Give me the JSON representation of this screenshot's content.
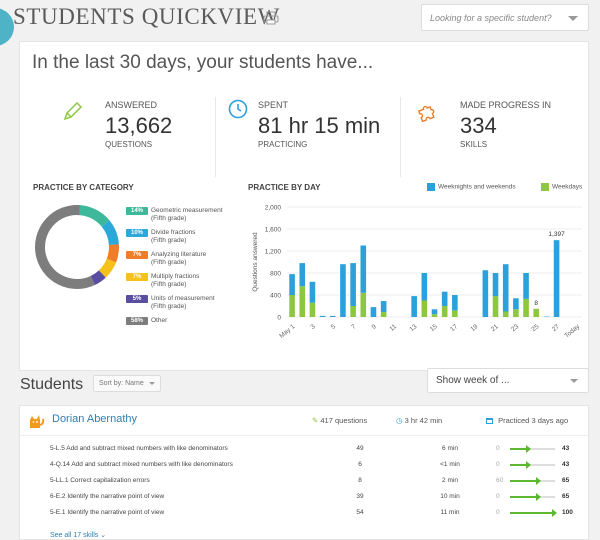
{
  "header": {
    "title": "STUDENTS QUICKVIEW",
    "search_placeholder": "Looking for a specific student?"
  },
  "summary": {
    "heading": "In the last 30 days, your students have...",
    "answered": {
      "label": "ANSWERED",
      "value": "13,662",
      "sub": "QUESTIONS"
    },
    "spent": {
      "label": "SPENT",
      "value": "81 hr 15 min",
      "sub": "PRACTICING"
    },
    "progress": {
      "label": "MADE PROGRESS IN",
      "value": "334",
      "sub": "SKILLS"
    }
  },
  "category": {
    "title": "PRACTICE BY CATEGORY",
    "items": [
      {
        "pct": "14%",
        "label": "Geometric measurement",
        "grade": "(Fifth grade)",
        "color": "#3db89a"
      },
      {
        "pct": "10%",
        "label": "Divide fractions",
        "grade": "(Fifth grade)",
        "color": "#2ca9d8"
      },
      {
        "pct": "7%",
        "label": "Analyzing literature",
        "grade": "(Fifth grade)",
        "color": "#ef7d2a"
      },
      {
        "pct": "7%",
        "label": "Multiply fractions",
        "grade": "(Fifth grade)",
        "color": "#f4c21a"
      },
      {
        "pct": "5%",
        "label": "Units of measurement",
        "grade": "(Fifth grade)",
        "color": "#5a4ea3"
      },
      {
        "pct": "58%",
        "label": "Other",
        "grade": "",
        "color": "#7d7d7d"
      }
    ]
  },
  "chart_data": {
    "type": "bar",
    "title": "PRACTICE BY DAY",
    "ylabel": "Questions answered",
    "xlabel": "",
    "ylim": [
      0,
      2000
    ],
    "yticks": [
      0,
      400,
      800,
      1200,
      1600,
      2000
    ],
    "tick_labels": [
      "May 1",
      "3",
      "5",
      "7",
      "9",
      "11",
      "13",
      "15",
      "17",
      "19",
      "21",
      "23",
      "25",
      "27",
      "Today"
    ],
    "categories": [
      "May 1",
      "2",
      "3",
      "4",
      "5",
      "6",
      "7",
      "8",
      "9",
      "10",
      "11",
      "12",
      "13",
      "14",
      "15",
      "16",
      "17",
      "18",
      "19",
      "20",
      "21",
      "22",
      "23",
      "24",
      "25",
      "26",
      "27",
      "28",
      "29"
    ],
    "series": [
      {
        "name": "Weeknights and weekends",
        "color": "#2ca0da",
        "values": [
          380,
          420,
          380,
          20,
          20,
          960,
          780,
          860,
          180,
          200,
          0,
          0,
          380,
          500,
          90,
          260,
          280,
          0,
          0,
          850,
          420,
          860,
          200,
          470,
          0,
          8,
          1397,
          0,
          0
        ]
      },
      {
        "name": "Weekdays",
        "color": "#8dc63f",
        "values": [
          400,
          560,
          260,
          0,
          0,
          0,
          200,
          440,
          0,
          90,
          0,
          0,
          0,
          300,
          50,
          200,
          120,
          0,
          0,
          0,
          380,
          100,
          140,
          330,
          150,
          0,
          0,
          0,
          0
        ]
      }
    ],
    "data_labels": [
      {
        "category": "25",
        "text": "8"
      },
      {
        "category": "27",
        "text": "1,397"
      }
    ]
  },
  "students": {
    "title": "Students",
    "sort_label": "Sort by: Name",
    "week_label": "Show week of ...",
    "card": {
      "name": "Dorian Abernathy",
      "questions": "417 questions",
      "time": "3 hr 42 min",
      "practiced": "Practiced 3 days ago",
      "skills": [
        {
          "skill": "5-L.5 Add and subtract mixed numbers with like denominators",
          "questions": "49",
          "time": "6 min",
          "from": "0",
          "to": "43",
          "progress": 0.43
        },
        {
          "skill": "4-Q.14 Add and subtract mixed numbers with like denominators",
          "questions": "6",
          "time": "<1 min",
          "from": "0",
          "to": "43",
          "progress": 0.43
        },
        {
          "skill": "5-LL.1 Correct capitalization errors",
          "questions": "8",
          "time": "2 min",
          "from": "60",
          "to": "65",
          "progress": 0.65
        },
        {
          "skill": "6-E.2 Identify the narrative point of view",
          "questions": "39",
          "time": "10 min",
          "from": "0",
          "to": "65",
          "progress": 0.65
        },
        {
          "skill": "5-E.1 Identify the narrative point of view",
          "questions": "54",
          "time": "11 min",
          "from": "0",
          "to": "100",
          "progress": 1.0
        }
      ],
      "see_all": "See all 17 skills"
    }
  }
}
